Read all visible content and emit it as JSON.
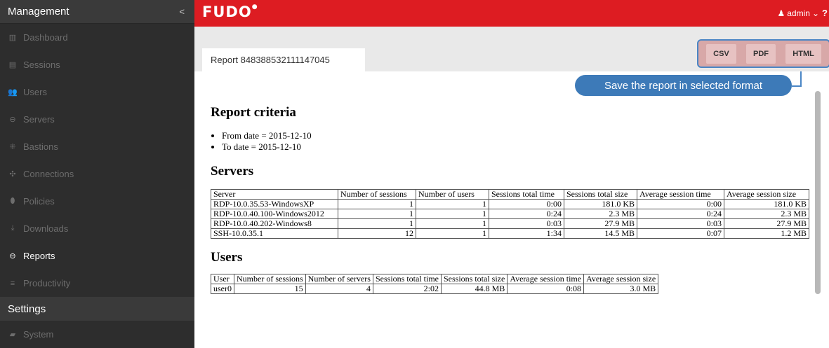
{
  "sidebar": {
    "management_title": "Management",
    "collapse_glyph": "<",
    "items": [
      {
        "label": "Dashboard",
        "icon": "dashboard-icon",
        "glyph": "▥"
      },
      {
        "label": "Sessions",
        "icon": "sessions-icon",
        "glyph": "▤"
      },
      {
        "label": "Users",
        "icon": "users-icon",
        "glyph": "👥"
      },
      {
        "label": "Servers",
        "icon": "server-icon",
        "glyph": "⊖"
      },
      {
        "label": "Bastions",
        "icon": "bastion-icon",
        "glyph": "⁜"
      },
      {
        "label": "Connections",
        "icon": "connections-icon",
        "glyph": "✣"
      },
      {
        "label": "Policies",
        "icon": "shield-icon",
        "glyph": "⬮"
      },
      {
        "label": "Downloads",
        "icon": "download-icon",
        "glyph": "⤓"
      },
      {
        "label": "Reports",
        "icon": "reports-icon",
        "glyph": "⊖"
      },
      {
        "label": "Productivity",
        "icon": "productivity-icon",
        "glyph": "≡"
      }
    ],
    "settings_title": "Settings",
    "settings_items": [
      {
        "label": "System",
        "icon": "folder-icon",
        "glyph": "▰"
      }
    ]
  },
  "topbar": {
    "logo": "FUDO",
    "user_label": "admin",
    "user_glyph": "♟",
    "chevron": "⌄",
    "help": "?"
  },
  "tab": {
    "label": "Report 848388532111147045"
  },
  "formats": {
    "csv": "CSV",
    "pdf": "PDF",
    "html": "HTML"
  },
  "tooltip": "Save the report in selected format",
  "report": {
    "criteria_title": "Report criteria",
    "criteria": [
      "From date = 2015-12-10",
      "To date = 2015-12-10"
    ],
    "servers_title": "Servers",
    "servers_headers": [
      "Server",
      "Number of sessions",
      "Number of users",
      "Sessions total time",
      "Sessions total size",
      "Average session time",
      "Average session size"
    ],
    "servers_rows": [
      [
        "RDP-10.0.35.53-WindowsXP",
        "1",
        "1",
        "0:00",
        "181.0 KB",
        "0:00",
        "181.0 KB"
      ],
      [
        "RDP-10.0.40.100-Windows2012",
        "1",
        "1",
        "0:24",
        "2.3 MB",
        "0:24",
        "2.3 MB"
      ],
      [
        "RDP-10.0.40.202-Windows8",
        "1",
        "1",
        "0:03",
        "27.9 MB",
        "0:03",
        "27.9 MB"
      ],
      [
        "SSH-10.0.35.1",
        "12",
        "1",
        "1:34",
        "14.5 MB",
        "0:07",
        "1.2 MB"
      ]
    ],
    "users_title": "Users",
    "users_headers": [
      "User",
      "Number of sessions",
      "Number of servers",
      "Sessions total time",
      "Sessions total size",
      "Average session time",
      "Average session size"
    ],
    "users_rows": [
      [
        "user0",
        "15",
        "4",
        "2:02",
        "44.8 MB",
        "0:08",
        "3.0 MB"
      ]
    ]
  },
  "colors": {
    "brand": "#dd1c22",
    "sidebar": "#2d2d2d",
    "accent": "#3d7ab8"
  }
}
